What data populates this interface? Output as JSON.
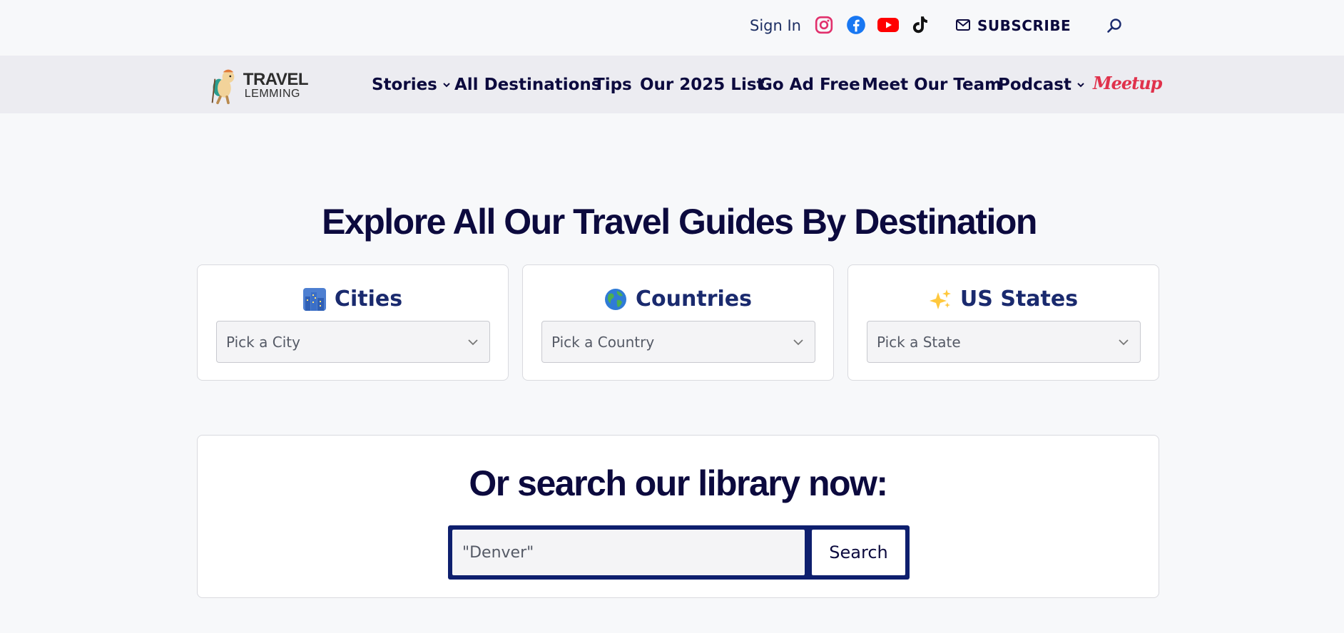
{
  "topbar": {
    "sign_in": "Sign In",
    "subscribe": "SUBSCRIBE",
    "social_icons": [
      "instagram-icon",
      "facebook-icon",
      "youtube-icon",
      "tiktok-icon"
    ]
  },
  "logo": {
    "line1": "TRAVEL",
    "line2": "LEMMING"
  },
  "nav": {
    "items": [
      {
        "label": "Stories",
        "has_dropdown": true
      },
      {
        "label": "All Destinations",
        "has_dropdown": false
      },
      {
        "label": "Tips",
        "has_dropdown": false
      },
      {
        "label": "Our 2025 List",
        "has_dropdown": false
      },
      {
        "label": "Go Ad Free",
        "has_dropdown": false
      },
      {
        "label": "Meet Our Team",
        "has_dropdown": false
      },
      {
        "label": "Podcast",
        "has_dropdown": true
      }
    ],
    "meetup": "Meetup"
  },
  "hero": {
    "title": "Explore All Our Travel Guides By Destination"
  },
  "cards": [
    {
      "title": "Cities",
      "icon": "cityscape-emoji-icon",
      "select_value": "Pick a City"
    },
    {
      "title": "Countries",
      "icon": "globe-emoji-icon",
      "select_value": "Pick a Country"
    },
    {
      "title": "US States",
      "icon": "sparkles-emoji-icon",
      "select_value": "Pick a State"
    }
  ],
  "search": {
    "title": "Or search our library now:",
    "placeholder": "\"Denver\"",
    "button": "Search"
  },
  "colors": {
    "primary": "#0c0a3e",
    "accent_navy": "#0e1f6e",
    "card_title": "#1a2a6e",
    "meetup_red": "#e0314b",
    "nav_bg": "#ececf1",
    "page_bg": "#f7f8fa"
  }
}
